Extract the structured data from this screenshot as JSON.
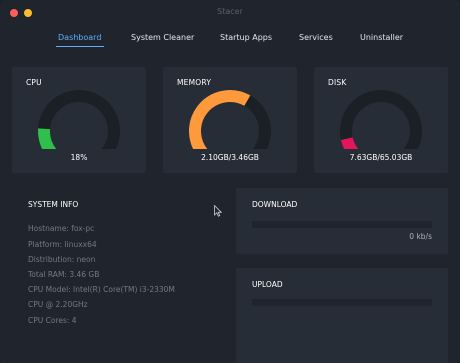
{
  "window": {
    "title": "Stacer"
  },
  "nav": {
    "tabs": [
      {
        "label": "Dashboard",
        "active": true
      },
      {
        "label": "System Cleaner",
        "active": false
      },
      {
        "label": "Startup Apps",
        "active": false
      },
      {
        "label": "Services",
        "active": false
      },
      {
        "label": "Uninstaller",
        "active": false
      }
    ]
  },
  "gauges": {
    "cpu": {
      "label": "CPU",
      "value": "18%",
      "fraction": 0.18,
      "color": "#2fbf4a"
    },
    "memory": {
      "label": "MEMORY",
      "value": "2.10GB/3.46GB",
      "fraction": 0.61,
      "color": "#ff9a3c"
    },
    "disk": {
      "label": "DISK",
      "value": "7.63GB/65.03GB",
      "fraction": 0.12,
      "color": "#e3165b"
    }
  },
  "gauge_track_color": "#1b1f26",
  "system_info": {
    "title": "SYSTEM INFO",
    "lines": [
      "Hostname: fox-pc",
      "Platform: linuxx64",
      "Distribution: neon",
      "Total RAM: 3.46 GB",
      "CPU Model: Intel(R) Core(TM) i3-2330M",
      "CPU @ 2.20GHz",
      "CPU Cores: 4"
    ]
  },
  "network": {
    "download": {
      "title": "DOWNLOAD",
      "value": "0 kb/s"
    },
    "upload": {
      "title": "UPLOAD"
    }
  }
}
